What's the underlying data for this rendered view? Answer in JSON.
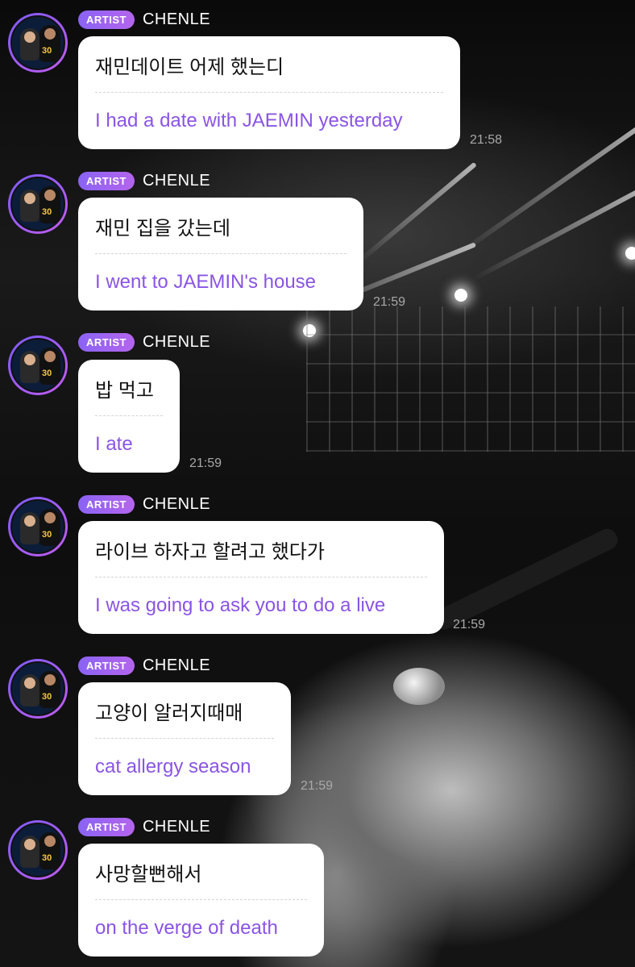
{
  "messages": [
    {
      "badge": "ARTIST",
      "name": "CHENLE",
      "original": "재민데이트 어제 했는디",
      "translation": "I had a date with JAEMIN yesterday",
      "time": "21:58"
    },
    {
      "badge": "ARTIST",
      "name": "CHENLE",
      "original": "재민 집을 갔는데",
      "translation": "I went to JAEMIN's house",
      "time": "21:59"
    },
    {
      "badge": "ARTIST",
      "name": "CHENLE",
      "original": "밥 먹고",
      "translation": "I ate",
      "time": "21:59"
    },
    {
      "badge": "ARTIST",
      "name": "CHENLE",
      "original": "라이브 하자고 할려고 했다가",
      "translation": "I was going to ask you to do a live",
      "time": "21:59"
    },
    {
      "badge": "ARTIST",
      "name": "CHENLE",
      "original": "고양이 알러지때매",
      "translation": "cat allergy season",
      "time": "21:59"
    },
    {
      "badge": "ARTIST",
      "name": "CHENLE",
      "original": "사망할뻔해서",
      "translation": "on the verge of death",
      "time": ""
    }
  ]
}
